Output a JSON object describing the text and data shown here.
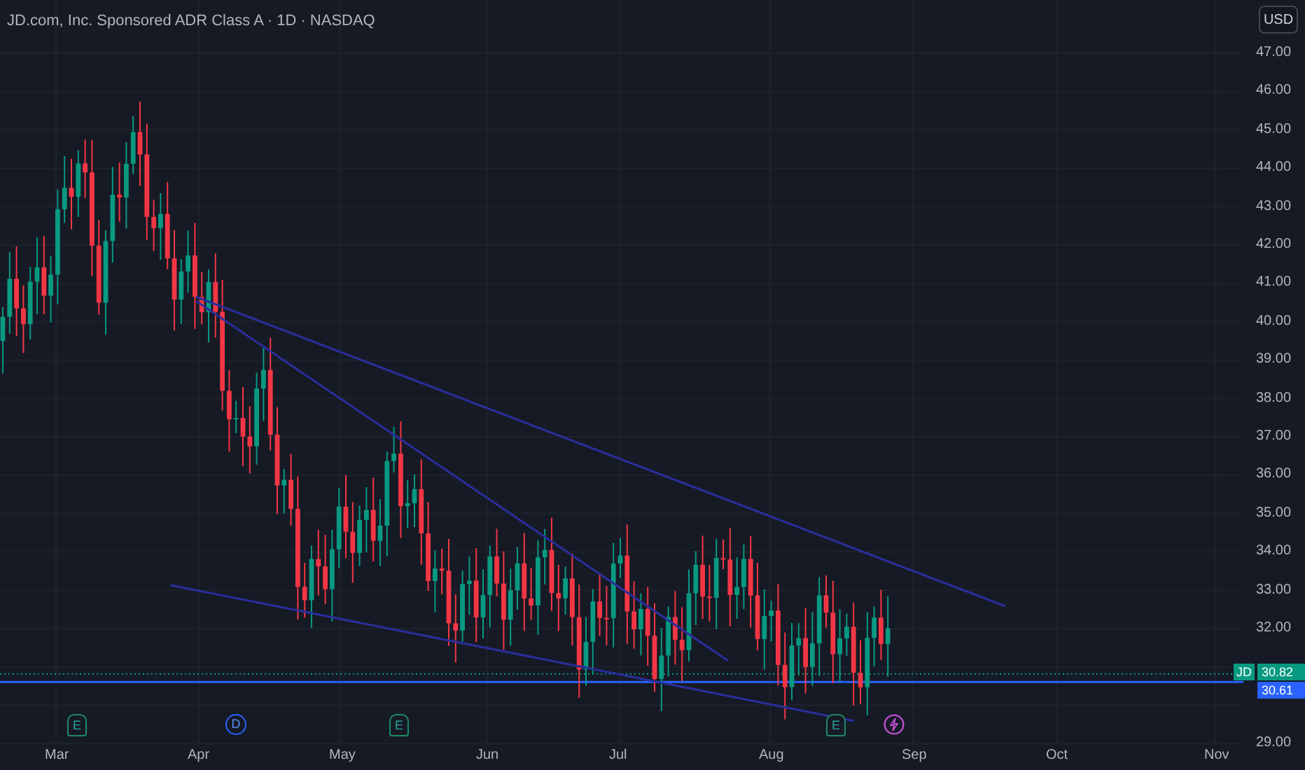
{
  "header": {
    "title": "JD.com, Inc. Sponsored ADR Class A · 1D · NASDAQ"
  },
  "currency_button": {
    "label": "USD"
  },
  "price_axis": {
    "labels": [
      "47.00",
      "46.00",
      "45.00",
      "44.00",
      "43.00",
      "42.00",
      "41.00",
      "40.00",
      "39.00",
      "38.00",
      "37.00",
      "36.00",
      "35.00",
      "34.00",
      "33.00",
      "32.00",
      "29.00"
    ]
  },
  "time_axis": {
    "labels": [
      "Mar",
      "Apr",
      "May",
      "Jun",
      "Jul",
      "Aug",
      "Sep",
      "Oct",
      "Nov"
    ]
  },
  "price_badges": [
    {
      "symbol": "JD",
      "value": "30.82",
      "color": "#089981"
    },
    {
      "value": "30.61",
      "color": "#2962ff"
    }
  ],
  "events": [
    {
      "kind": "earnings",
      "label": "E"
    },
    {
      "kind": "dividend",
      "label": "D"
    },
    {
      "kind": "earnings",
      "label": "E"
    },
    {
      "kind": "earnings",
      "label": "E"
    },
    {
      "kind": "split"
    }
  ]
}
